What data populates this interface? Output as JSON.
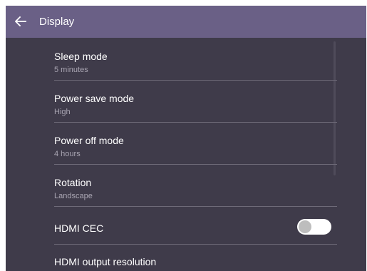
{
  "header": {
    "title": "Display",
    "back_icon": "arrow-left-icon"
  },
  "settings": {
    "sleep_mode": {
      "label": "Sleep mode",
      "value": "5 minutes"
    },
    "power_save_mode": {
      "label": "Power save mode",
      "value": "High"
    },
    "power_off_mode": {
      "label": "Power off mode",
      "value": "4 hours"
    },
    "rotation": {
      "label": "Rotation",
      "value": "Landscape"
    },
    "hdmi_cec": {
      "label": "HDMI CEC",
      "enabled": false
    },
    "hdmi_output_resolution": {
      "label": "HDMI output resolution"
    }
  },
  "colors": {
    "header": "#6a6086",
    "background": "#3f3b4a",
    "divider": "#6e6a78"
  }
}
